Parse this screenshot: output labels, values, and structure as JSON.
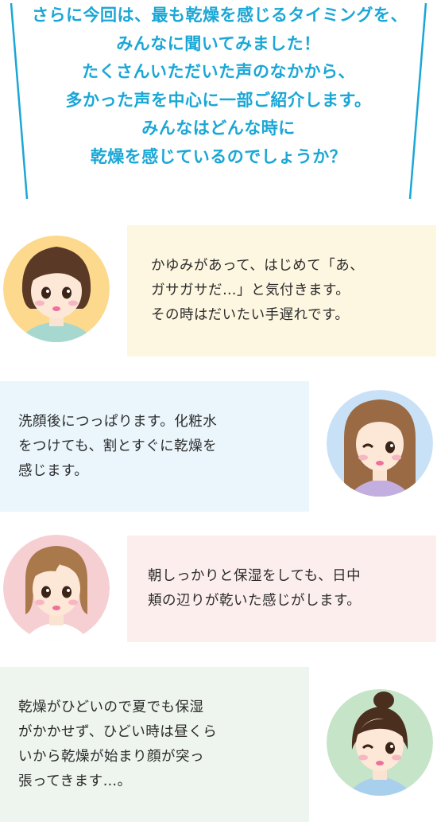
{
  "intro": {
    "lines": [
      "さらに今回は、最も乾燥を感じるタイミングを、",
      "みんなに聞いてみました！",
      "たくさんいただいた声のなかから、",
      "多かった声を中心に一部ご紹介します。",
      "みんなはどんな時に",
      "乾燥を感じているのでしょうか？"
    ],
    "color": "#1aa7d6"
  },
  "comments": [
    {
      "lines": [
        "かゆみがあって、はじめて「あ、",
        "ガサガサだ…」と気付きます。",
        "その時はだいたい手遅れです。"
      ],
      "bubble_color": "#fdf6e0",
      "avatar_bg": "#fcd98c",
      "avatar_icon": "woman-short-dark-hair-icon"
    },
    {
      "lines": [
        "洗顔後につっぱります。化粧水",
        "をつけても、割とすぐに乾燥を",
        "感じます。"
      ],
      "bubble_color": "#eaf6fc",
      "avatar_bg": "#c9e1f6",
      "avatar_icon": "woman-long-hair-winking-icon"
    },
    {
      "lines": [
        "朝しっかりと保湿をしても、日中",
        "頬の辺りが乾いた感じがします。"
      ],
      "bubble_color": "#fdeeee",
      "avatar_bg": "#f6cfd3",
      "avatar_icon": "woman-bob-hair-icon"
    },
    {
      "lines": [
        "乾燥がひどいので夏でも保湿",
        "がかかせず、ひどい時は昼くら",
        "いから乾燥が始まり顔が突っ",
        "張ってきます…。"
      ],
      "bubble_color": "#eef4ee",
      "avatar_bg": "#c5e4c8",
      "avatar_icon": "woman-bun-hair-winking-icon"
    }
  ]
}
